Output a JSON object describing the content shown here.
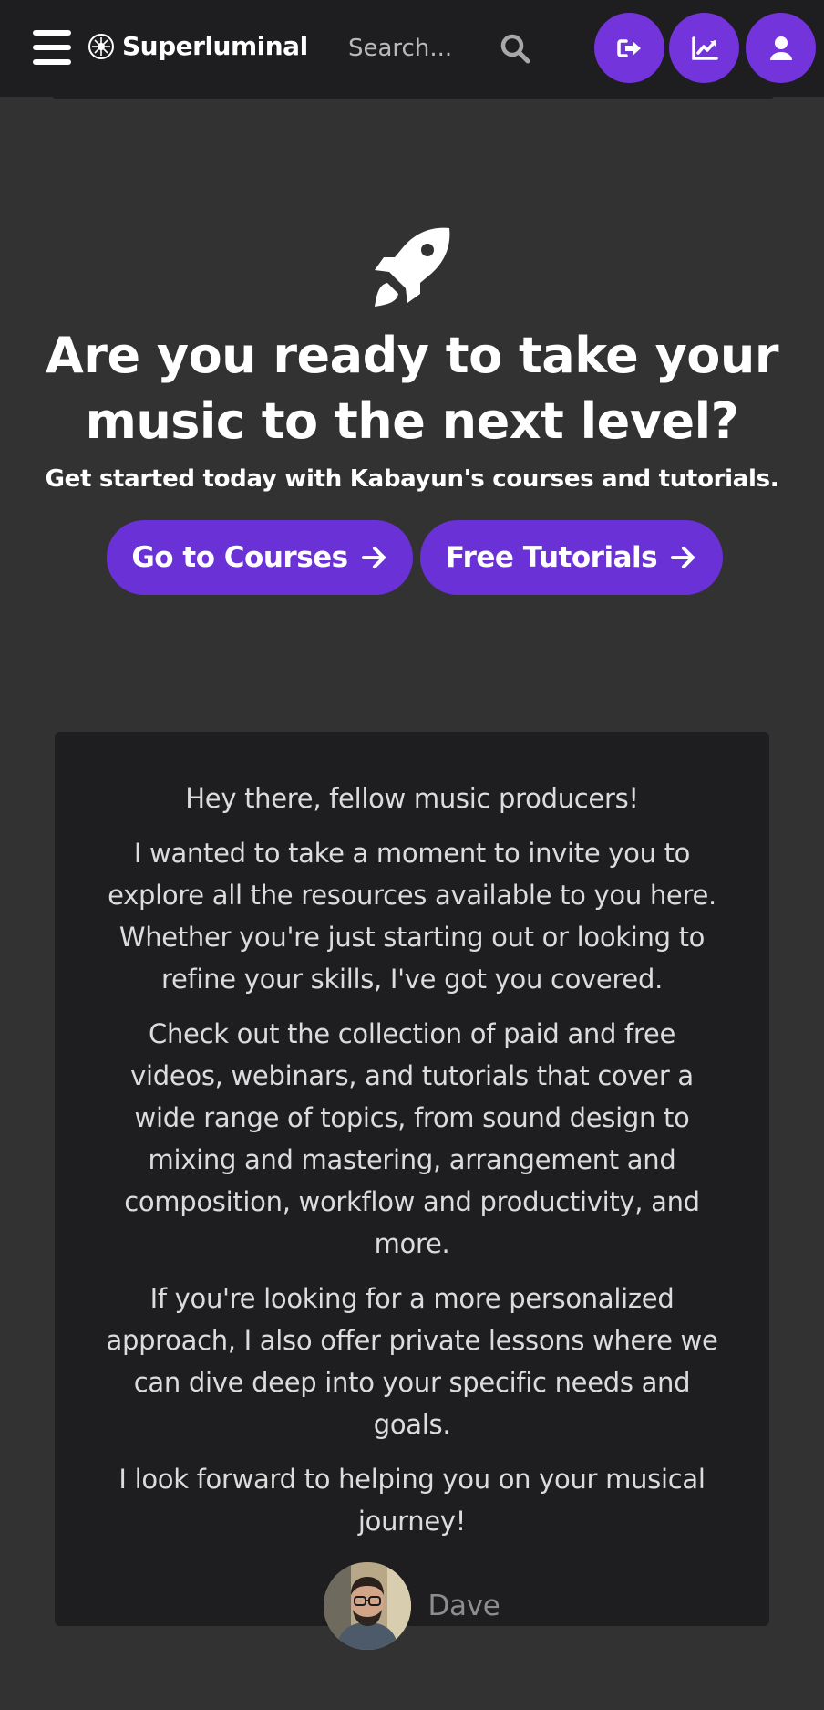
{
  "header": {
    "brand_name": "Superluminal",
    "search_placeholder": "Search...",
    "accent_color": "#7434db",
    "actions": [
      {
        "icon": "sign-out-icon"
      },
      {
        "icon": "chart-line-icon"
      },
      {
        "icon": "user-icon"
      }
    ]
  },
  "hero": {
    "icon": "rocket-icon",
    "title": "Are you ready to take your music to the next level?",
    "subtitle": "Get started today with Kabayun's courses and tutorials.",
    "buttons": {
      "courses": "Go to Courses",
      "tutorials": "Free Tutorials"
    }
  },
  "letter": {
    "paragraphs": [
      "Hey there, fellow music producers!",
      "I wanted to take a moment to invite you to explore all the resources available to you here. Whether you're just starting out or looking to refine your skills, I've got you covered.",
      "Check out the collection of paid and free videos, webinars, and tutorials that cover a wide range of topics, from sound design to mixing and mastering, arrangement and composition, workflow and productivity, and more.",
      "If you're looking for a more personalized approach, I also offer private lessons where we can dive deep into your specific needs and goals.",
      "I look forward to helping you on your musical journey!"
    ],
    "signature_name": "Dave"
  }
}
